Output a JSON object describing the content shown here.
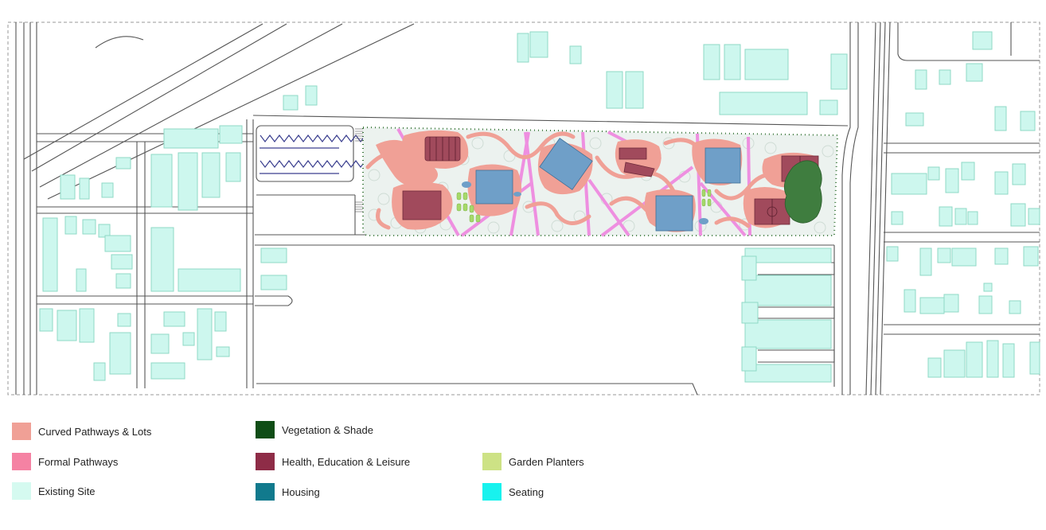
{
  "legend": {
    "items": [
      {
        "label": "Curved Pathways & Lots",
        "color": "#f0a096"
      },
      {
        "label": "Formal Pathways",
        "color": "#f582a3"
      },
      {
        "label": "Existing Site",
        "color": "#d5faf0"
      },
      {
        "label": "Vegetation & Shade",
        "color": "#0f4d16"
      },
      {
        "label": "Health, Education & Leisure",
        "color": "#8e2c47"
      },
      {
        "label": "Housing",
        "color": "#117a8d"
      },
      {
        "label": "Garden Planters",
        "color": "#cde285"
      },
      {
        "label": "Seating",
        "color": "#18f2ee"
      }
    ]
  },
  "colors": {
    "existing_building_fill": "#cdf7ee",
    "existing_building_stroke": "#8fd9c6",
    "road_line": "#555555",
    "park_fill": "#ecf2ef",
    "tree_canopy": "#d9e3dd",
    "hedge_dots": "#3e7a3e",
    "curved_pathways": "#f0a096",
    "formal_pathways": "#ee8fe0",
    "housing_block": "#6f9fc8",
    "health_block": "#a14a5c",
    "vegetation_dark": "#3f7d3f",
    "garden_planters": "#a6d96a"
  }
}
